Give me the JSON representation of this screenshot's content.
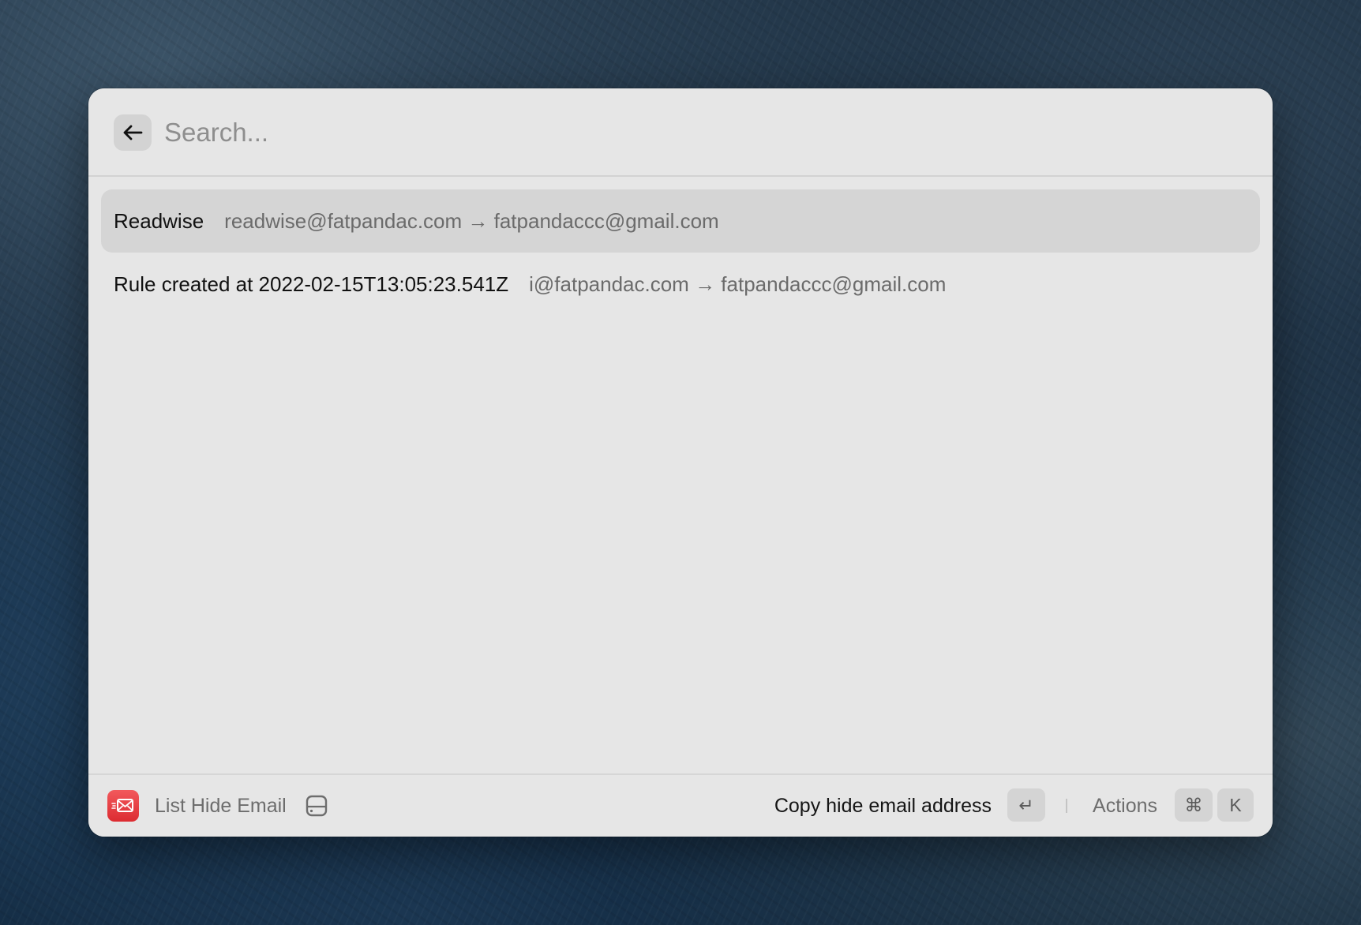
{
  "search": {
    "placeholder": "Search...",
    "value": ""
  },
  "list": {
    "items": [
      {
        "title": "Readwise",
        "subtitle": "readwise@fatpandac.com → fatpandaccc@gmail.com",
        "selected": true
      },
      {
        "title": "Rule created at 2022-02-15T13:05:23.541Z",
        "subtitle": "i@fatpandac.com → fatpandaccc@gmail.com",
        "selected": false
      }
    ]
  },
  "footer": {
    "app_icon": "mail-forward-icon",
    "command_title": "List Hide Email",
    "status_icon": "drive-icon",
    "primary_action": "Copy hide email address",
    "primary_shortcut": "↵",
    "actions_label": "Actions",
    "actions_shortcut": [
      "⌘",
      "K"
    ]
  },
  "colors": {
    "window_bg": "#e6e6e6",
    "selected_row": "#d5d5d5",
    "app_icon": "#e53a3f"
  }
}
